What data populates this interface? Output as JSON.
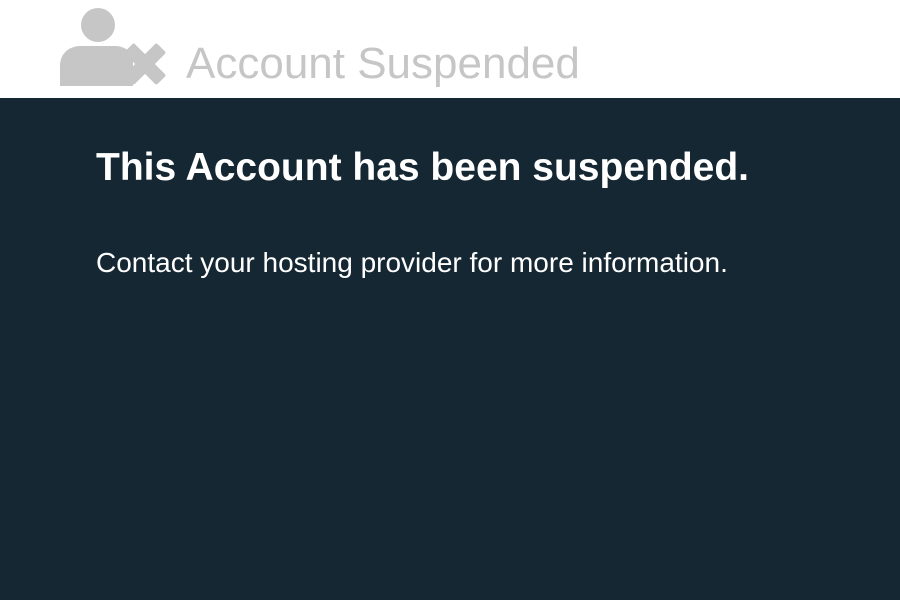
{
  "header": {
    "title": "Account Suspended",
    "icon": "user-suspended-icon",
    "title_color": "#c6c6c6",
    "icon_color": "#c6c6c6"
  },
  "panel": {
    "headline": "This Account has been suspended.",
    "message": "Contact your hosting provider for more information.",
    "background_color": "#152733",
    "text_color": "#ffffff"
  }
}
